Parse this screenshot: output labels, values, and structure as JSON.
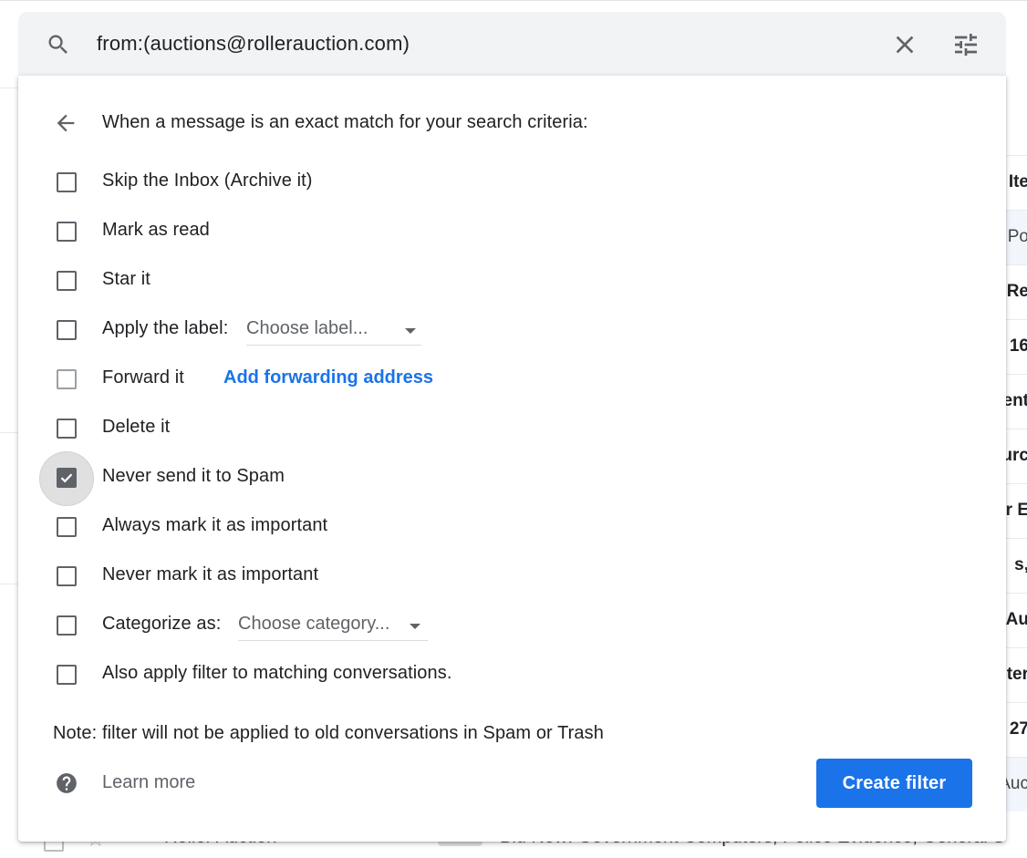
{
  "search": {
    "query": "from:(auctions@rollerauction.com)",
    "search_icon": "search-icon",
    "clear_icon": "close-icon",
    "options_icon": "tune-icon"
  },
  "filter": {
    "heading": "When a message is an exact match for your search criteria:",
    "back_icon": "arrow-back-icon",
    "options": [
      {
        "label": "Skip the Inbox (Archive it)",
        "checked": false
      },
      {
        "label": "Mark as read",
        "checked": false
      },
      {
        "label": "Star it",
        "checked": false
      },
      {
        "label": "Apply the label:",
        "checked": false,
        "dropdown": "Choose label..."
      },
      {
        "label": "Forward it",
        "checked": false,
        "link": "Add forwarding address"
      },
      {
        "label": "Delete it",
        "checked": false
      },
      {
        "label": "Never send it to Spam",
        "checked": true
      },
      {
        "label": "Always mark it as important",
        "checked": false
      },
      {
        "label": "Never mark it as important",
        "checked": false
      },
      {
        "label": "Categorize as:",
        "checked": false,
        "dropdown": "Choose category..."
      },
      {
        "label": "Also apply filter to matching conversations.",
        "checked": false
      }
    ],
    "note": "Note: filter will not be applied to old conversations in Spam or Trash",
    "learn_more": "Learn more",
    "help_icon": "help-icon",
    "create_button": "Create filter"
  },
  "background": {
    "right_fragments": [
      "Ite",
      "Po",
      "Re",
      "16",
      "ent",
      "urc",
      "r E",
      "s,",
      "Au",
      "ter",
      "27",
      "Auc"
    ],
    "bottom_row": {
      "sender": "Roller Auction",
      "tag": "Inbox",
      "subject": "Bid Now: Government Computers, Police Evidence, General S"
    }
  },
  "colors": {
    "accent": "#1a73e8",
    "search_bg": "#f1f3f4",
    "icon": "#5f6368"
  }
}
